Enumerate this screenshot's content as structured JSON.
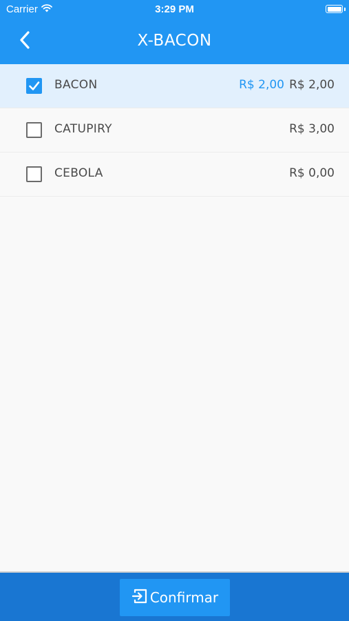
{
  "status_bar": {
    "carrier": "Carrier",
    "time": "3:29 PM",
    "wifi_icon": "wifi-icon",
    "battery_icon": "battery-icon"
  },
  "nav": {
    "back_icon": "chevron-left-icon",
    "title": "X-BACON"
  },
  "items": [
    {
      "name": "BACON",
      "checked": true,
      "price_extra": "R$ 2,00",
      "price": "R$ 2,00"
    },
    {
      "name": "CATUPIRY",
      "checked": false,
      "price": "R$ 3,00"
    },
    {
      "name": "CEBOLA",
      "checked": false,
      "price": "R$ 0,00"
    }
  ],
  "footer": {
    "confirm_label": "Confirmar",
    "confirm_icon": "sign-in-icon"
  },
  "colors": {
    "primary": "#2196f3",
    "footer": "#1976d2",
    "selected_row": "#e2f0fd",
    "text": "#4a4a4a",
    "background": "#f9f9f9"
  }
}
